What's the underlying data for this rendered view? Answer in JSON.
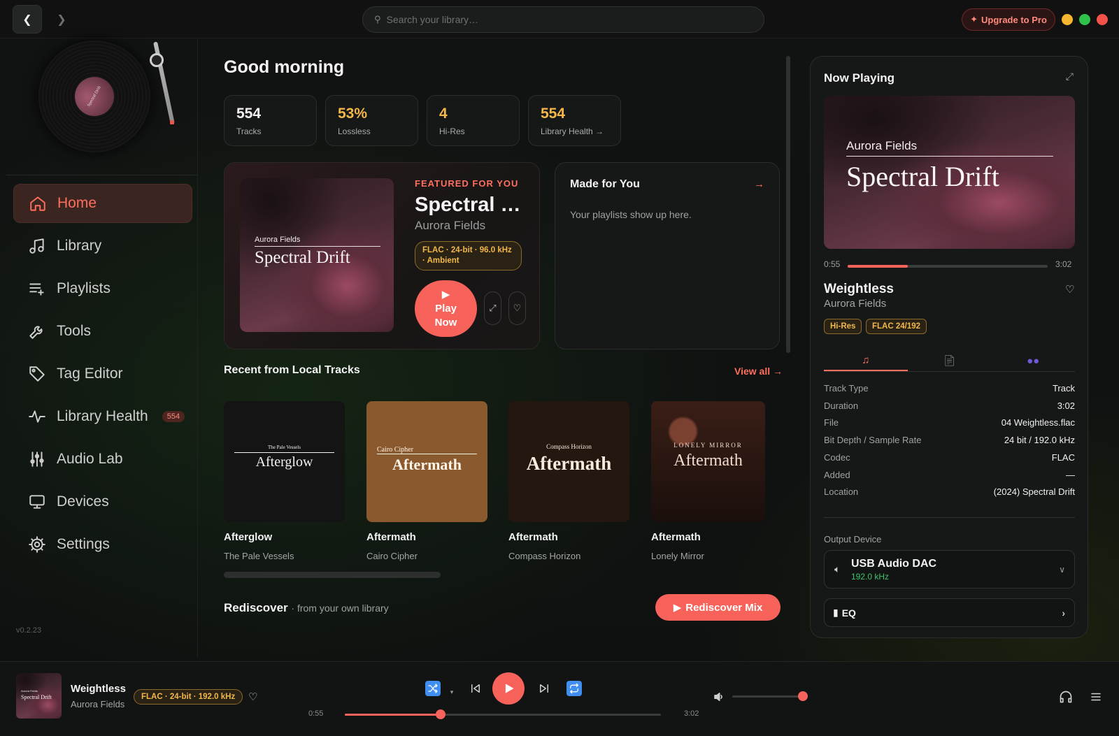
{
  "titlebar": {
    "search_placeholder": "Search your library…",
    "upgrade_label": "Upgrade to Pro",
    "window_dot_colors": [
      "#f4b530",
      "#2fc24a",
      "#f2524a"
    ]
  },
  "sidebar": {
    "record_label": "Spectral Drift",
    "nav": [
      {
        "label": "Home",
        "icon": "home-icon",
        "active": true
      },
      {
        "label": "Library",
        "icon": "music-note-icon"
      },
      {
        "label": "Playlists",
        "icon": "playlist-icon"
      },
      {
        "label": "Tools",
        "icon": "wrench-icon"
      },
      {
        "label": "Tag Editor",
        "icon": "tag-icon"
      },
      {
        "label": "Library Health",
        "icon": "pulse-icon",
        "badge": "554"
      },
      {
        "label": "Audio Lab",
        "icon": "sliders-icon"
      },
      {
        "label": "Devices",
        "icon": "monitor-icon"
      },
      {
        "label": "Settings",
        "icon": "gear-icon"
      }
    ],
    "version": "v0.2.23"
  },
  "main": {
    "greeting": "Good morning",
    "stats": [
      {
        "value": "554",
        "label": "Tracks",
        "accent": false
      },
      {
        "value": "53%",
        "label": "Lossless",
        "accent": true
      },
      {
        "value": "4",
        "label": "Hi-Res",
        "accent": true
      },
      {
        "value": "554",
        "label": "Library Health →",
        "accent": true
      }
    ],
    "featured": {
      "kicker": "FEATURED FOR YOU",
      "title": "Spectral Drift",
      "artist": "Aurora Fields",
      "art_artist": "Aurora Fields",
      "art_album": "Spectral Drift",
      "badge": "FLAC · 24-bit · 96.0 kHz · Ambient",
      "play_label": "Play Now"
    },
    "made_for_you": {
      "title": "Made for You",
      "arrow": "→",
      "empty": "Your playlists show up here."
    },
    "recent": {
      "title": "Recent from Local Tracks",
      "view_all": "View all →",
      "items": [
        {
          "title": "Afterglow",
          "artist": "The Pale Vessels",
          "art_artist": "The Pale Vessels",
          "art_title": "Afterglow",
          "bg": "#141414"
        },
        {
          "title": "Aftermath",
          "artist": "Cairo Cipher",
          "art_artist": "Cairo Cipher",
          "art_title": "Aftermath",
          "bg": "#8a5a2e"
        },
        {
          "title": "Aftermath",
          "artist": "Compass Horizon",
          "art_artist": "Compass Horizon",
          "art_title": "Aftermath",
          "bg": "#231710"
        },
        {
          "title": "Aftermath",
          "artist": "Lonely Mirror",
          "art_artist": "LONELY MIRROR",
          "art_title": "Aftermath",
          "bg": "#3a1e16"
        }
      ]
    },
    "rediscover": {
      "title": "Rediscover",
      "subtitle": "· from your own library",
      "button": "Rediscover Mix"
    }
  },
  "now_playing": {
    "header": "Now Playing",
    "art_artist": "Aurora Fields",
    "art_album": "Spectral Drift",
    "elapsed": "0:55",
    "duration": "3:02",
    "progress": 0.302,
    "title": "Weightless",
    "artist": "Aurora Fields",
    "pills": [
      "Hi-Res",
      "FLAC 24/192"
    ],
    "tabs": [
      "music-note-icon",
      "document-icon",
      "people-icon"
    ],
    "details": [
      {
        "k": "Track Type",
        "v": "Track"
      },
      {
        "k": "Duration",
        "v": "3:02"
      },
      {
        "k": "File",
        "v": "04 Weightless.flac"
      },
      {
        "k": "Bit Depth / Sample Rate",
        "v": "24 bit / 192.0 kHz"
      },
      {
        "k": "Codec",
        "v": "FLAC"
      },
      {
        "k": "Added",
        "v": "—"
      },
      {
        "k": "Location",
        "v": "(2024) Spectral Drift"
      }
    ],
    "output_label": "Output Device",
    "device_name": "USB Audio DAC",
    "device_rate": "192.0 kHz",
    "eq_label": "EQ"
  },
  "player": {
    "title": "Weightless",
    "artist": "Aurora Fields",
    "badge": "FLAC · 24-bit · 192.0 kHz",
    "elapsed": "0:55",
    "duration": "3:02",
    "progress": 0.302,
    "volume": 0.95,
    "colors": {
      "accent": "#f7635a",
      "gold": "#f2b84a",
      "blue": "#3f8ef0"
    }
  }
}
